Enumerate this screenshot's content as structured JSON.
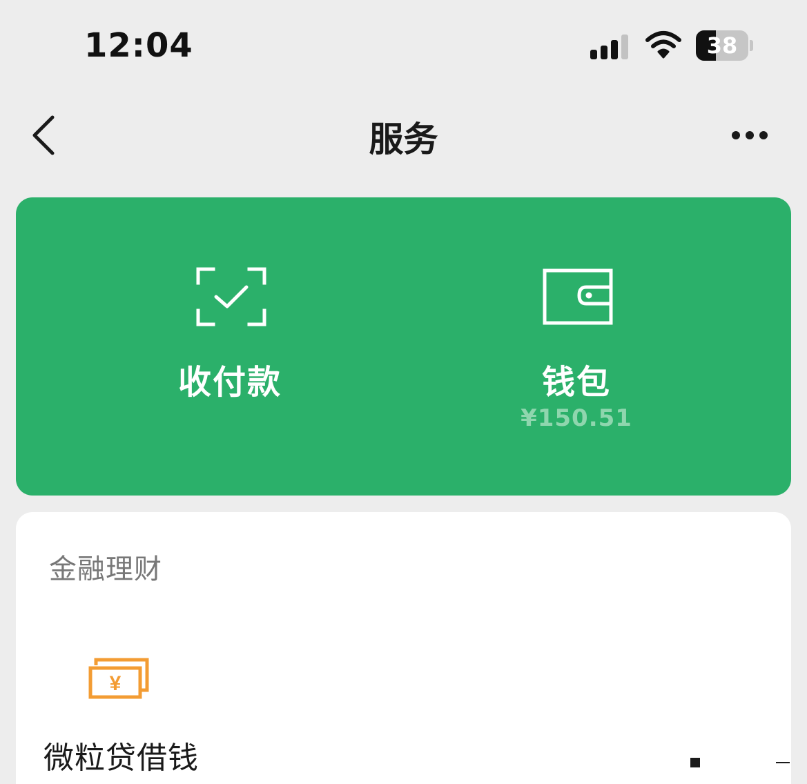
{
  "status_bar": {
    "time": "12:04",
    "signal_bars_active": 3,
    "signal_bars_total": 4,
    "battery_level": "38",
    "battery_fraction": 0.38
  },
  "nav": {
    "title": "服务",
    "back_icon": "chevron-left-icon",
    "more_icon": "ellipsis-icon"
  },
  "pay_card": {
    "background_color": "#2bb06a",
    "items": [
      {
        "label": "收付款",
        "icon": "scan-check-icon"
      },
      {
        "label": "钱包",
        "icon": "wallet-icon",
        "balance": "¥150.51"
      }
    ]
  },
  "finance": {
    "title": "金融理财",
    "items": [
      {
        "label": "微粒贷借钱",
        "icon": "cash-yuan-icon",
        "icon_color": "#f39c33"
      }
    ]
  }
}
